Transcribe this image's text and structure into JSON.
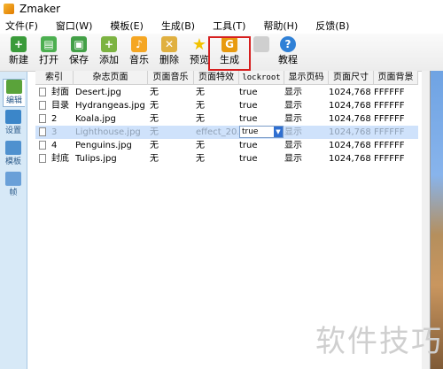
{
  "window": {
    "title": "Zmaker"
  },
  "menu": [
    {
      "label": "文件(F)"
    },
    {
      "label": "窗口(W)"
    },
    {
      "label": "模板(E)"
    },
    {
      "label": "生成(B)"
    },
    {
      "label": "工具(T)"
    },
    {
      "label": "帮助(H)"
    },
    {
      "label": "反馈(B)"
    }
  ],
  "toolbar": [
    {
      "label": "新建",
      "icon": "new-icon",
      "color": "#3a9b3a"
    },
    {
      "label": "打开",
      "icon": "open-icon",
      "color": "#4caf50"
    },
    {
      "label": "保存",
      "icon": "save-icon",
      "color": "#43a047"
    },
    {
      "label": "添加",
      "icon": "add-icon",
      "color": "#7cb342"
    },
    {
      "label": "音乐",
      "icon": "music-icon",
      "color": "#f5a623"
    },
    {
      "label": "删除",
      "icon": "delete-icon",
      "color": "#e0b040"
    },
    {
      "label": "预览",
      "icon": "star-icon",
      "color": "#f2c200"
    },
    {
      "label": "生成",
      "icon": "generate-icon",
      "color": "#e89a10"
    },
    {
      "label": "",
      "icon": "disabled-icon",
      "color": "#cfcfcf"
    },
    {
      "label": "教程",
      "icon": "help-icon",
      "color": "#2f80d6"
    }
  ],
  "sidebar": [
    {
      "label": "编辑",
      "icon": "edit-icon"
    },
    {
      "label": "设置",
      "icon": "settings-icon"
    },
    {
      "label": "模板",
      "icon": "template-icon"
    },
    {
      "label": "帧",
      "icon": "frame-icon"
    }
  ],
  "grid": {
    "columns": [
      "索引",
      "杂志页面",
      "页面音乐",
      "页面特效",
      "lockroot",
      "显示页码",
      "页面尺寸",
      "页面背景"
    ],
    "rows": [
      {
        "index": "封面",
        "page": "Desert.jpg",
        "music": "无",
        "effect": "无",
        "lockroot": "true",
        "pagenum": "显示",
        "size": "1024,768",
        "bg": "FFFFFF"
      },
      {
        "index": "目录",
        "page": "Hydrangeas.jpg",
        "music": "无",
        "effect": "无",
        "lockroot": "true",
        "pagenum": "显示",
        "size": "1024,768",
        "bg": "FFFFFF"
      },
      {
        "index": "2",
        "page": "Koala.jpg",
        "music": "无",
        "effect": "无",
        "lockroot": "true",
        "pagenum": "显示",
        "size": "1024,768",
        "bg": "FFFFFF"
      },
      {
        "index": "3",
        "page": "Lighthouse.jpg",
        "music": "无",
        "effect": "effect_20...",
        "lockroot": "true",
        "pagenum": "显示",
        "size": "1024,768",
        "bg": "FFFFFF"
      },
      {
        "index": "4",
        "page": "Penguins.jpg",
        "music": "无",
        "effect": "无",
        "lockroot": "true",
        "pagenum": "显示",
        "size": "1024,768",
        "bg": "FFFFFF"
      },
      {
        "index": "封底",
        "page": "Tulips.jpg",
        "music": "无",
        "effect": "无",
        "lockroot": "true",
        "pagenum": "显示",
        "size": "1024,768",
        "bg": "FFFFFF"
      }
    ]
  },
  "watermark": "软件技巧"
}
